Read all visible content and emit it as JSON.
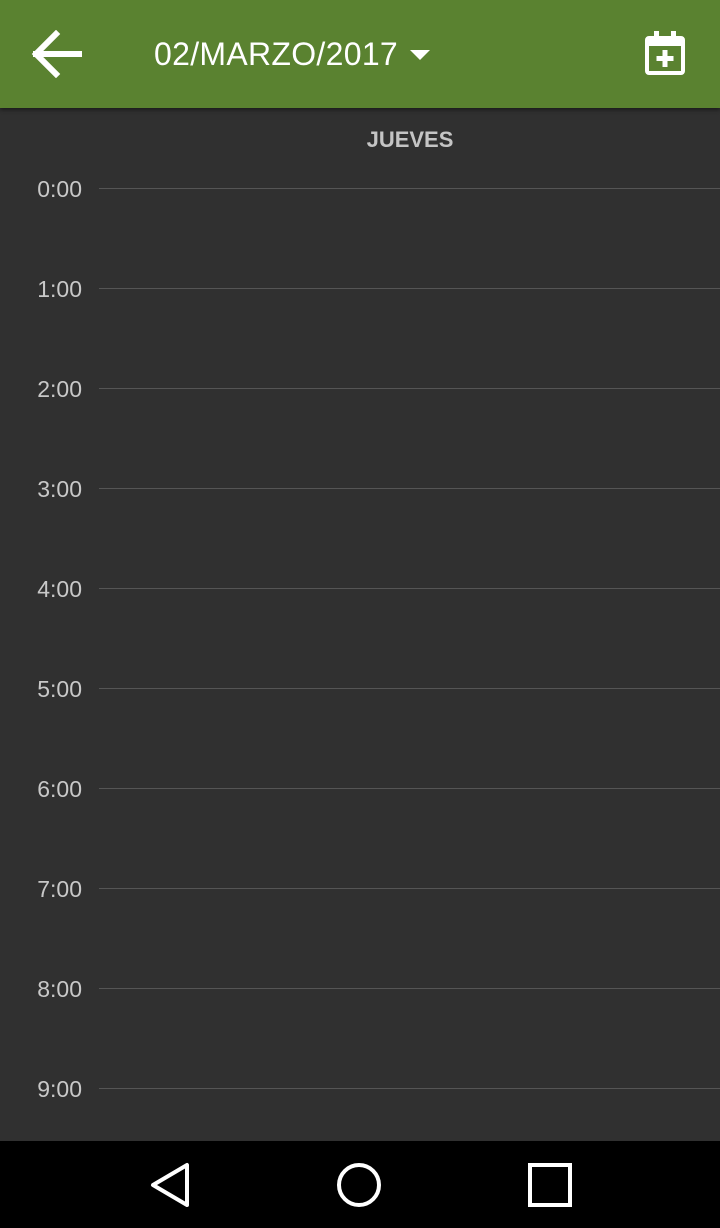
{
  "toolbar": {
    "back_icon": "arrow-back-icon",
    "date": "02/MARZO/2017",
    "date_dropdown_icon": "caret-down-icon",
    "add_event_icon": "calendar-plus-icon",
    "background_color": "#5a8230"
  },
  "day_view": {
    "weekday": "JUEVES",
    "hours": [
      "0:00",
      "1:00",
      "2:00",
      "3:00",
      "4:00",
      "5:00",
      "6:00",
      "7:00",
      "8:00",
      "9:00"
    ],
    "background_color": "#303030"
  },
  "navbar": {
    "back_icon": "nav-back-triangle-icon",
    "home_icon": "nav-home-circle-icon",
    "recents_icon": "nav-recents-square-icon"
  }
}
